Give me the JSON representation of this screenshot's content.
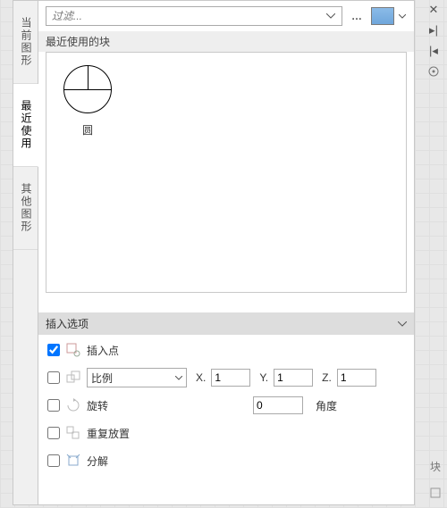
{
  "filter": {
    "placeholder": "过滤..."
  },
  "side_tabs": [
    {
      "id": "current",
      "label": "当前图形"
    },
    {
      "id": "recent",
      "label": "最近使用"
    },
    {
      "id": "other",
      "label": "其他图形"
    }
  ],
  "active_tab": "recent",
  "recent_section_label": "最近使用的块",
  "blocks": [
    {
      "name": "圆",
      "kind": "circle"
    }
  ],
  "options_header": "插入选项",
  "options": {
    "insertion_point": {
      "label": "插入点",
      "checked": true
    },
    "scale": {
      "label": "比例",
      "checked": false,
      "x": "1",
      "y": "1",
      "z": "1",
      "x_label": "X.",
      "y_label": "Y.",
      "z_label": "Z."
    },
    "rotation": {
      "label": "旋转",
      "checked": false,
      "value": "0",
      "unit_label": "角度"
    },
    "repeat": {
      "label": "重复放置",
      "checked": false
    },
    "explode": {
      "label": "分解",
      "checked": false
    }
  }
}
